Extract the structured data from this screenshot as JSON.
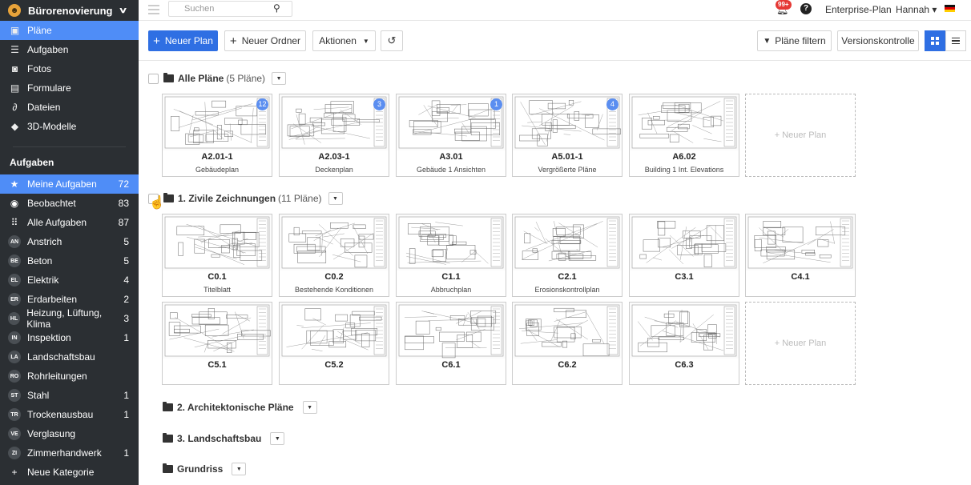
{
  "sidebar": {
    "project": "Bürorenovierung",
    "nav": [
      {
        "icon": "plans-icon",
        "glyph": "▣",
        "label": "Pläne"
      },
      {
        "icon": "tasks-icon",
        "glyph": "☰",
        "label": "Aufgaben"
      },
      {
        "icon": "camera-icon",
        "glyph": "◙",
        "label": "Fotos"
      },
      {
        "icon": "forms-icon",
        "glyph": "▤",
        "label": "Formulare"
      },
      {
        "icon": "paperclip-icon",
        "glyph": "∂",
        "label": "Dateien"
      },
      {
        "icon": "cube-icon",
        "glyph": "◆",
        "label": "3D-Modelle"
      }
    ],
    "tasks_header": "Aufgaben",
    "tasks": [
      {
        "ab": "★",
        "label": "Meine Aufgaben",
        "count": "72"
      },
      {
        "ab": "◉",
        "label": "Beobachtet",
        "count": "83"
      },
      {
        "ab": "⠿",
        "label": "Alle Aufgaben",
        "count": "87"
      },
      {
        "ab": "AN",
        "label": "Anstrich",
        "count": "5"
      },
      {
        "ab": "BE",
        "label": "Beton",
        "count": "5"
      },
      {
        "ab": "EL",
        "label": "Elektrik",
        "count": "4"
      },
      {
        "ab": "ER",
        "label": "Erdarbeiten",
        "count": "2"
      },
      {
        "ab": "HL",
        "label": "Heizung, Lüftung, Klima",
        "count": "3"
      },
      {
        "ab": "IN",
        "label": "Inspektion",
        "count": "1"
      },
      {
        "ab": "LA",
        "label": "Landschaftsbau",
        "count": ""
      },
      {
        "ab": "RO",
        "label": "Rohrleitungen",
        "count": ""
      },
      {
        "ab": "ST",
        "label": "Stahl",
        "count": "1"
      },
      {
        "ab": "TR",
        "label": "Trockenausbau",
        "count": "1"
      },
      {
        "ab": "VE",
        "label": "Verglasung",
        "count": ""
      },
      {
        "ab": "ZI",
        "label": "Zimmerhandwerk",
        "count": "1"
      },
      {
        "ab": "+",
        "label": "Neue Kategorie",
        "count": ""
      }
    ]
  },
  "topbar": {
    "search_placeholder": "Suchen",
    "notif_badge": "99+",
    "help": "?",
    "plan": "Enterprise-Plan",
    "user": "Hannah ▾"
  },
  "toolbar": {
    "new_plan": "Neuer Plan",
    "new_folder": "Neuer Ordner",
    "actions": "Aktionen",
    "filter": "Pläne filtern",
    "versions": "Versionskontrolle"
  },
  "folders": [
    {
      "name": "Alle Pläne",
      "count": "(5 Pläne)",
      "sheets": [
        {
          "code": "A2.01-1",
          "title": "Gebäudeplan",
          "badge": "12"
        },
        {
          "code": "A2.03-1",
          "title": "Deckenplan",
          "badge": "3"
        },
        {
          "code": "A3.01",
          "title": "Gebäude 1 Ansichten",
          "badge": "1"
        },
        {
          "code": "A5.01-1",
          "title": "Vergrößerte Pläne",
          "badge": "4"
        },
        {
          "code": "A6.02",
          "title": "Building 1 Int. Elevations",
          "badge": ""
        }
      ],
      "new_label": "+ Neuer Plan"
    },
    {
      "name": "1. Zivile Zeichnungen",
      "count": "(11 Pläne)",
      "sheets": [
        {
          "code": "C0.1",
          "title": "Titelblatt",
          "badge": ""
        },
        {
          "code": "C0.2",
          "title": "Bestehende Konditionen",
          "badge": ""
        },
        {
          "code": "C1.1",
          "title": "Abbruchplan",
          "badge": ""
        },
        {
          "code": "C2.1",
          "title": "Erosionskontrollplan",
          "badge": ""
        },
        {
          "code": "C3.1",
          "title": "",
          "badge": ""
        },
        {
          "code": "C4.1",
          "title": "",
          "badge": ""
        },
        {
          "code": "C5.1",
          "title": "",
          "badge": ""
        },
        {
          "code": "C5.2",
          "title": "",
          "badge": ""
        },
        {
          "code": "C6.1",
          "title": "",
          "badge": ""
        },
        {
          "code": "C6.2",
          "title": "",
          "badge": ""
        },
        {
          "code": "C6.3",
          "title": "",
          "badge": ""
        }
      ],
      "new_label": "+ Neuer Plan"
    },
    {
      "name": "2. Architektonische Pläne"
    },
    {
      "name": "3. Landschaftsbau"
    },
    {
      "name": "Grundriss"
    }
  ]
}
